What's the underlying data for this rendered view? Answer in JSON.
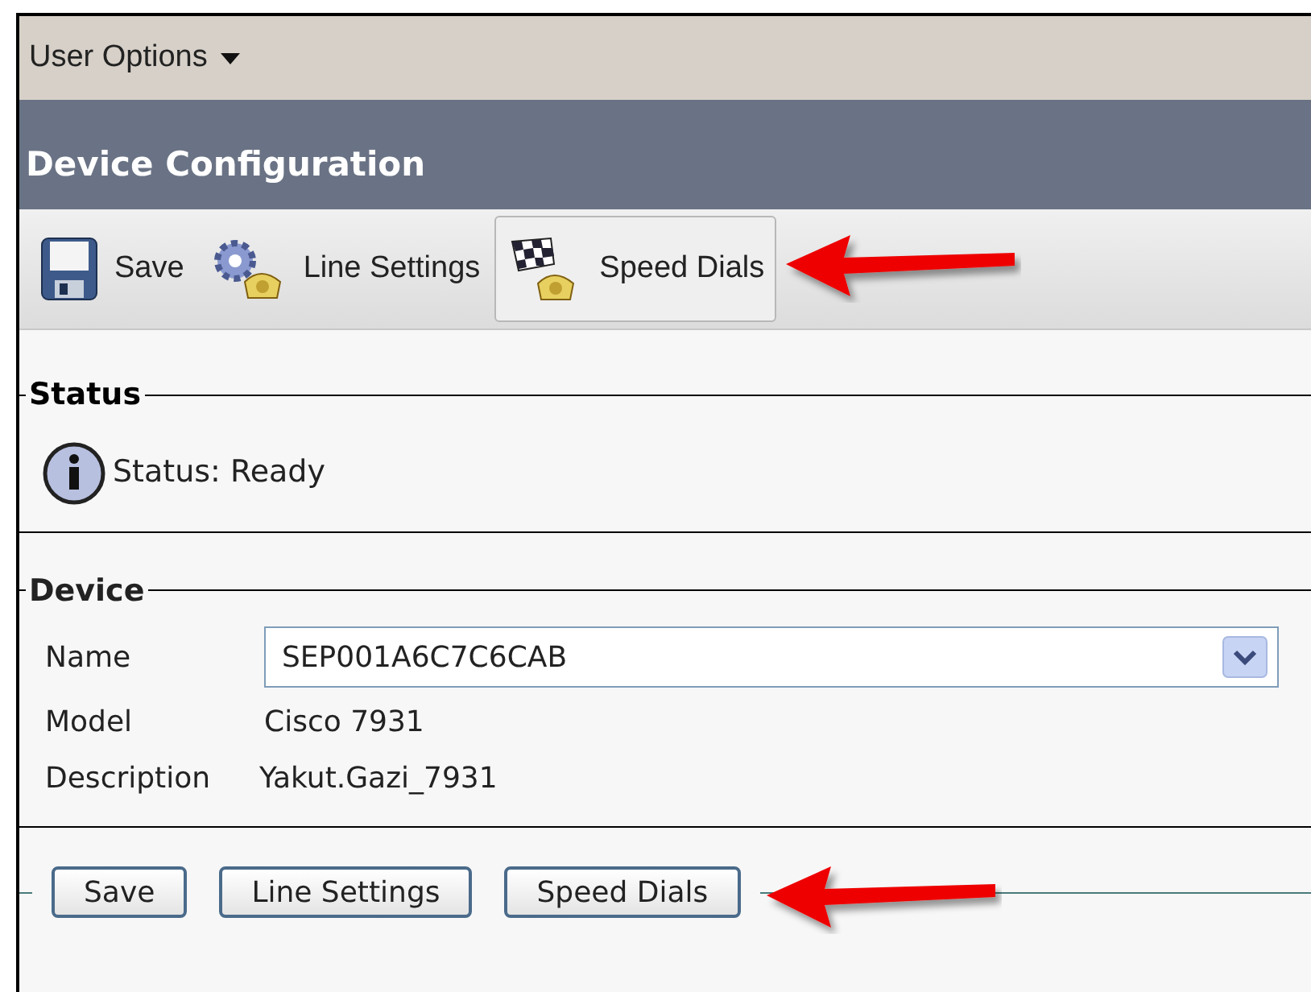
{
  "menu": {
    "label": "User Options"
  },
  "header": {
    "title": "Device Configuration"
  },
  "toolbar": [
    {
      "kind": "save",
      "label": "Save",
      "selected": false
    },
    {
      "kind": "settings",
      "label": "Line Settings",
      "selected": false
    },
    {
      "kind": "speed",
      "label": "Speed Dials",
      "selected": true
    }
  ],
  "status": {
    "legend": "Status",
    "message": "Status: Ready"
  },
  "device": {
    "legend": "Device",
    "name_label": "Name",
    "name_value": "SEP001A6C7C6CAB",
    "model_label": "Model",
    "model_value": "Cisco 7931",
    "description_label": "Description",
    "description_value": "Yakut.Gazi_7931"
  },
  "buttons": [
    "Save",
    "Line Settings",
    "Speed Dials"
  ]
}
